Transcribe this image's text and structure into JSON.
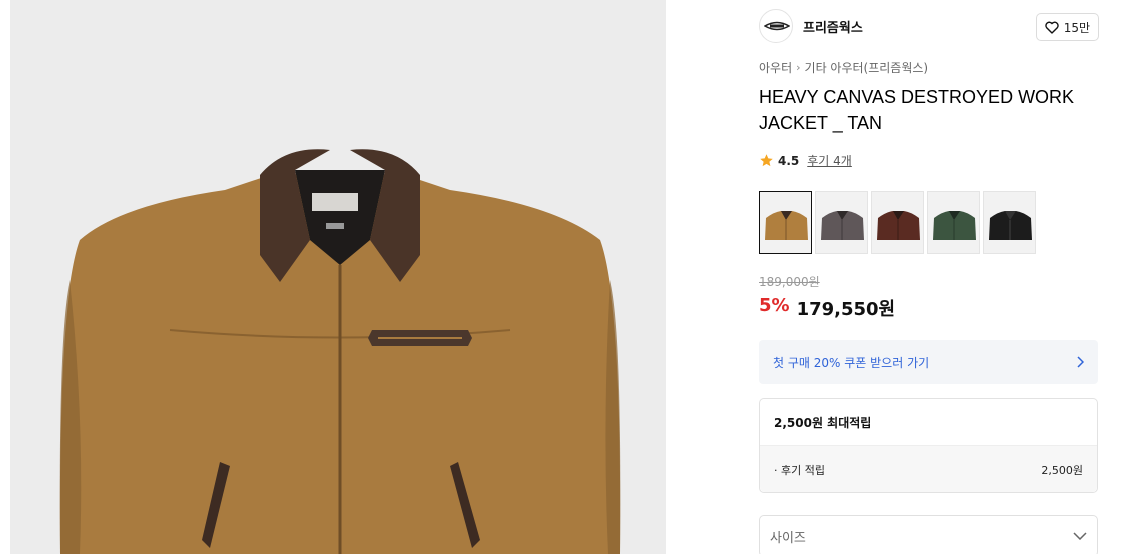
{
  "brand": {
    "name": "프리즘웍스",
    "logo_icon": "brand-logo-icon"
  },
  "like": {
    "count": "15만",
    "icon": "heart-icon"
  },
  "breadcrumb": {
    "items": [
      "아우터",
      "기타 아우터(프리즘웍스)"
    ],
    "separator_icon": "chevron-right-icon"
  },
  "product": {
    "title": "HEAVY CANVAS DESTROYED WORK JACKET _ TAN",
    "rating": "4.5",
    "reviews_label": "후기 4개",
    "star_color": "#f5a623"
  },
  "colors": {
    "selected_index": 0,
    "swatches": [
      {
        "name": "tan-swatch",
        "color": "#b07f3e"
      },
      {
        "name": "gray-swatch",
        "color": "#5f5759"
      },
      {
        "name": "brown-swatch",
        "color": "#5a2b22"
      },
      {
        "name": "green-swatch",
        "color": "#3c5540"
      },
      {
        "name": "black-swatch",
        "color": "#1c1c1c"
      }
    ]
  },
  "price": {
    "original": "189,000원",
    "discount": "5%",
    "sale": "179,550원",
    "discount_color": "#e02a2a"
  },
  "coupon": {
    "label": "첫 구매 20% 쿠폰 받으러 가기",
    "icon": "chevron-right-icon",
    "color": "#2f63d8"
  },
  "points": {
    "header": "2,500원 최대적립",
    "rows": [
      {
        "label": "· 후기 적립",
        "value": "2,500원"
      }
    ]
  },
  "size_select": {
    "placeholder": "사이즈",
    "icon": "chevron-down-icon"
  }
}
